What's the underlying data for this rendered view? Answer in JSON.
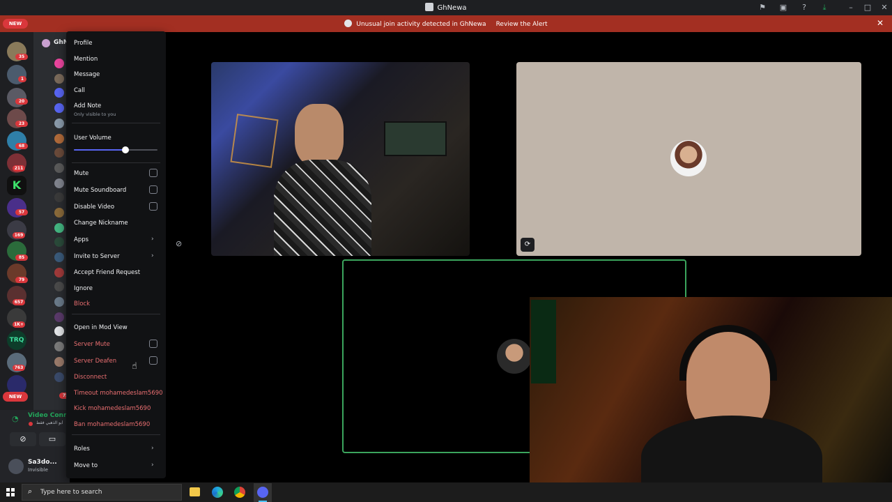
{
  "window": {
    "title": "GhNewa"
  },
  "alert": {
    "text": "Unusual join activity detected in GhNewa",
    "action": "Review the Alert"
  },
  "guild_badges": [
    "35",
    "1",
    "20",
    "23",
    "68",
    "211",
    "57",
    "169",
    "85",
    "79",
    "657",
    "1K+",
    "763"
  ],
  "new_label": "NEW",
  "server_header": "GhN",
  "voice": {
    "status": "Video Conne",
    "subtitle": "أبو الذهبي فقط"
  },
  "user": {
    "name": "Sa3do...",
    "status": "Invisible"
  },
  "sidebar_badge": "75",
  "menu": {
    "profile": "Profile",
    "mention": "Mention",
    "message": "Message",
    "call": "Call",
    "add_note": "Add Note",
    "add_note_hint": "Only visible to you",
    "user_volume": "User Volume",
    "user_volume_level": 0.62,
    "mute": "Mute",
    "mute_soundboard": "Mute Soundboard",
    "disable_video": "Disable Video",
    "change_nickname": "Change Nickname",
    "apps": "Apps",
    "invite": "Invite to Server",
    "accept_friend": "Accept Friend Request",
    "ignore": "Ignore",
    "block": "Block",
    "mod_view": "Open in Mod View",
    "server_mute": "Server Mute",
    "server_deafen": "Server Deafen",
    "disconnect": "Disconnect",
    "timeout": "Timeout mohamedeslam5690",
    "kick": "Kick mohamedeslam5690",
    "ban": "Ban mohamedeslam5690",
    "roles": "Roles",
    "move_to": "Move to"
  },
  "taskbar": {
    "search_placeholder": "Type here to search"
  },
  "colors": {
    "accent": "#5865f2",
    "danger": "#da373c",
    "alert_bg": "#a32f22",
    "speaking": "#3ba55d"
  }
}
